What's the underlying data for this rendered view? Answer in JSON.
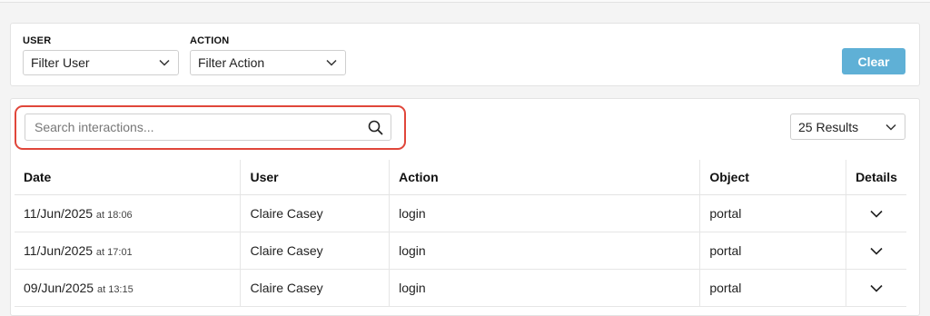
{
  "filters": {
    "user": {
      "label": "USER",
      "value": "Filter User"
    },
    "action": {
      "label": "ACTION",
      "value": "Filter Action"
    },
    "clear_label": "Clear"
  },
  "search": {
    "placeholder": "Search interactions..."
  },
  "results_count": "25 Results",
  "table": {
    "headers": {
      "date": "Date",
      "user": "User",
      "action": "Action",
      "object": "Object",
      "details": "Details"
    },
    "rows": [
      {
        "date": "11/Jun/2025",
        "time": "at 18:06",
        "user": "Claire Casey",
        "action": "login",
        "object": "portal"
      },
      {
        "date": "11/Jun/2025",
        "time": "at 17:01",
        "user": "Claire Casey",
        "action": "login",
        "object": "portal"
      },
      {
        "date": "09/Jun/2025",
        "time": "at 13:15",
        "user": "Claire Casey",
        "action": "login",
        "object": "portal"
      }
    ]
  },
  "colors": {
    "accent": "#5fb0d6",
    "highlight": "#e0463a"
  }
}
